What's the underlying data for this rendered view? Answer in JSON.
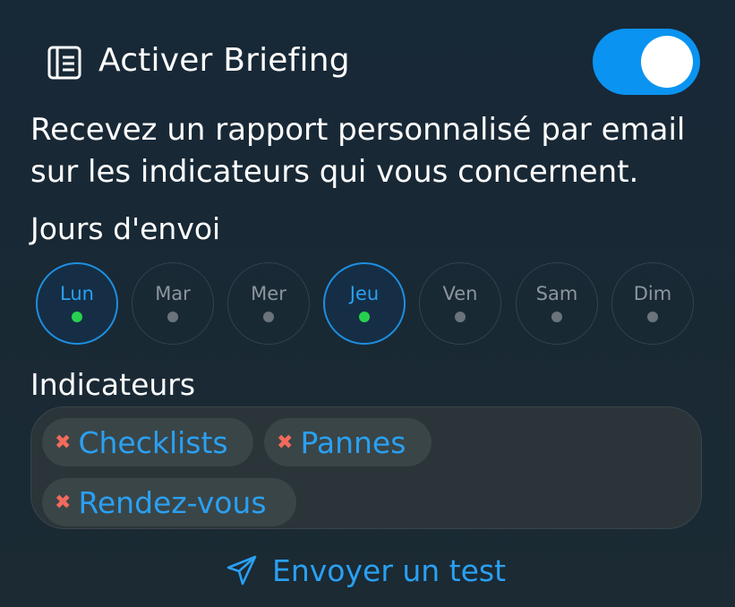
{
  "header": {
    "title": "Activer Briefing",
    "icon": "document-icon",
    "toggle_on": true
  },
  "description": "Recevez un rapport personnalisé par email sur les indicateurs qui vous concernent.",
  "days_section": {
    "label": "Jours d'envoi",
    "days": [
      {
        "label": "Lun",
        "active": true
      },
      {
        "label": "Mar",
        "active": false
      },
      {
        "label": "Mer",
        "active": false
      },
      {
        "label": "Jeu",
        "active": true
      },
      {
        "label": "Ven",
        "active": false
      },
      {
        "label": "Sam",
        "active": false
      },
      {
        "label": "Dim",
        "active": false
      }
    ]
  },
  "indicators_section": {
    "label": "Indicateurs",
    "chips": [
      {
        "label": "Checklists"
      },
      {
        "label": "Pannes"
      },
      {
        "label": "Rendez-vous"
      }
    ]
  },
  "send_test": {
    "label": "Envoyer un test",
    "icon": "paper-plane-icon"
  },
  "colors": {
    "accent": "#0a93f0",
    "active_dot": "#28d04f",
    "remove_x": "#f26a5c"
  }
}
